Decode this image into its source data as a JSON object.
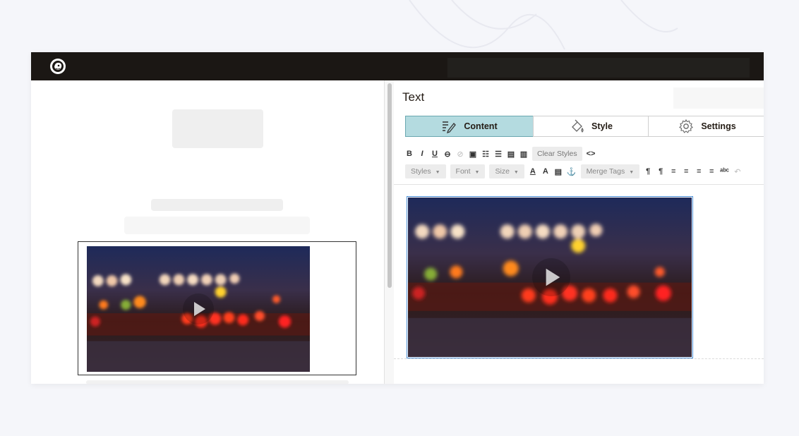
{
  "app": {
    "logo_icon": "mailchimp-freddie-icon"
  },
  "editor": {
    "title": "Text",
    "tabs": [
      {
        "label": "Content",
        "icon": "edit-pencil-icon",
        "active": true
      },
      {
        "label": "Style",
        "icon": "paint-bucket-icon",
        "active": false
      },
      {
        "label": "Settings",
        "icon": "gear-icon",
        "active": false
      }
    ],
    "toolbar_row1": {
      "bold": "B",
      "italic": "I",
      "underline": "U",
      "link": "⊖",
      "unlink": "⊘",
      "image": "▣",
      "ordered_list": "☷",
      "bullet_list": "☰",
      "paste": "▤",
      "paste_plain": "▥",
      "clear_styles": "Clear Styles",
      "source": "<>"
    },
    "toolbar_row2": {
      "styles": "Styles",
      "font": "Font",
      "size": "Size",
      "text_color": "A",
      "bg_color": "A",
      "horizontal_rule": "▤",
      "anchor": "⚓",
      "merge_tags": "Merge Tags",
      "ltr": "¶",
      "rtl": "¶",
      "align_left": "≡",
      "align_center": "≡",
      "align_right": "≡",
      "justify": "≡",
      "spellcheck": "ᵃᵇᶜ",
      "undo": "↶"
    }
  },
  "video": {
    "play_icon": "play-icon"
  },
  "colors": {
    "topbar": "#1b1714",
    "active_tab": "#b4dbe0",
    "selection_border": "#4b8fd6"
  }
}
